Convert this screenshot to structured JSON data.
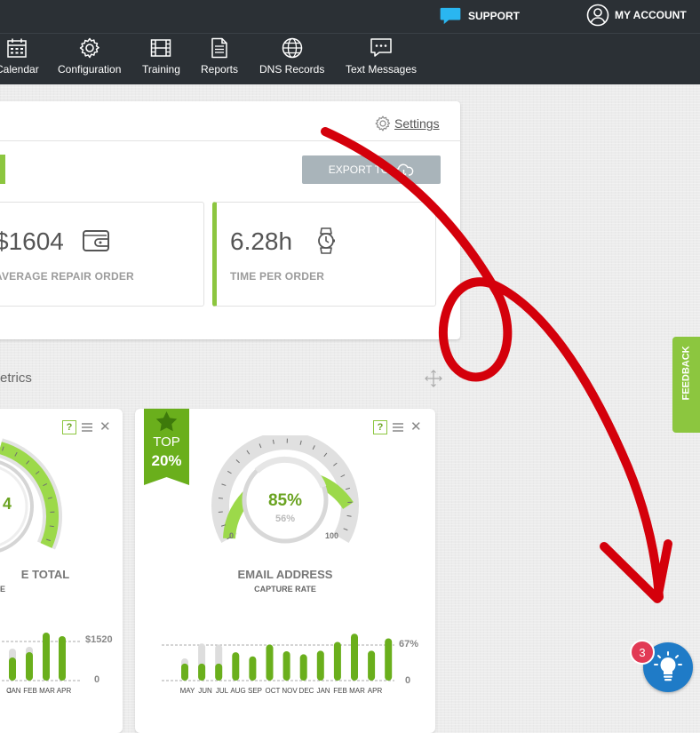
{
  "topbar": {
    "support_label": "SUPPORT",
    "account_label": "MY ACCOUNT"
  },
  "nav": {
    "items": [
      {
        "label": "Calendar",
        "icon": "calendar-icon"
      },
      {
        "label": "Configuration",
        "icon": "gear-icon"
      },
      {
        "label": "Training",
        "icon": "film-icon"
      },
      {
        "label": "Reports",
        "icon": "document-icon"
      },
      {
        "label": "DNS Records",
        "icon": "globe-icon"
      },
      {
        "label": "Text Messages",
        "icon": "chat-icon"
      }
    ]
  },
  "panel": {
    "settings_label": "Settings",
    "export_label": "EXPORT TO",
    "stats": [
      {
        "value": "$1604",
        "label": "AVERAGE REPAIR ORDER",
        "icon": "wallet-icon"
      },
      {
        "value": "6.28h",
        "label": "TIME PER ORDER",
        "icon": "watch-icon"
      }
    ]
  },
  "metrics": {
    "section_title": "etrics",
    "cards": [
      {
        "title": "E TOTAL",
        "subtitle": "E",
        "axis_max": "$1520",
        "axis_min": "0",
        "months": [
          "C",
          "JAN",
          "FEB",
          "MAR",
          "APR"
        ]
      },
      {
        "ribbon_top": "TOP",
        "ribbon_pct": "20%",
        "gauge_value": "85%",
        "gauge_target": "56%",
        "gauge_min": "0",
        "gauge_max": "100",
        "title": "EMAIL ADDRESS",
        "subtitle": "CAPTURE RATE",
        "axis_max": "67%",
        "axis_min": "0",
        "months": [
          "MAY",
          "JUN",
          "JUL",
          "AUG",
          "SEP",
          "OCT",
          "NOV",
          "DEC",
          "JAN",
          "FEB",
          "MAR",
          "APR"
        ],
        "bar_values": [
          0.33,
          0.33,
          0.33,
          0.55,
          0.47,
          0.7,
          0.57,
          0.51,
          0.58,
          0.75,
          0.91,
          0.58,
          0.82
        ],
        "bar_prev_values": [
          0.43,
          0.72,
          0.7
        ]
      }
    ]
  },
  "feedback_label": "FEEDBACK",
  "notification_count": "3",
  "colors": {
    "brand_green": "#8cc63f",
    "dark_green": "#6aa321",
    "nav_bg": "#2b3035",
    "bulb_blue": "#1f7bc7",
    "badge_red": "#e23a55",
    "arrow_red": "#d4000b"
  }
}
